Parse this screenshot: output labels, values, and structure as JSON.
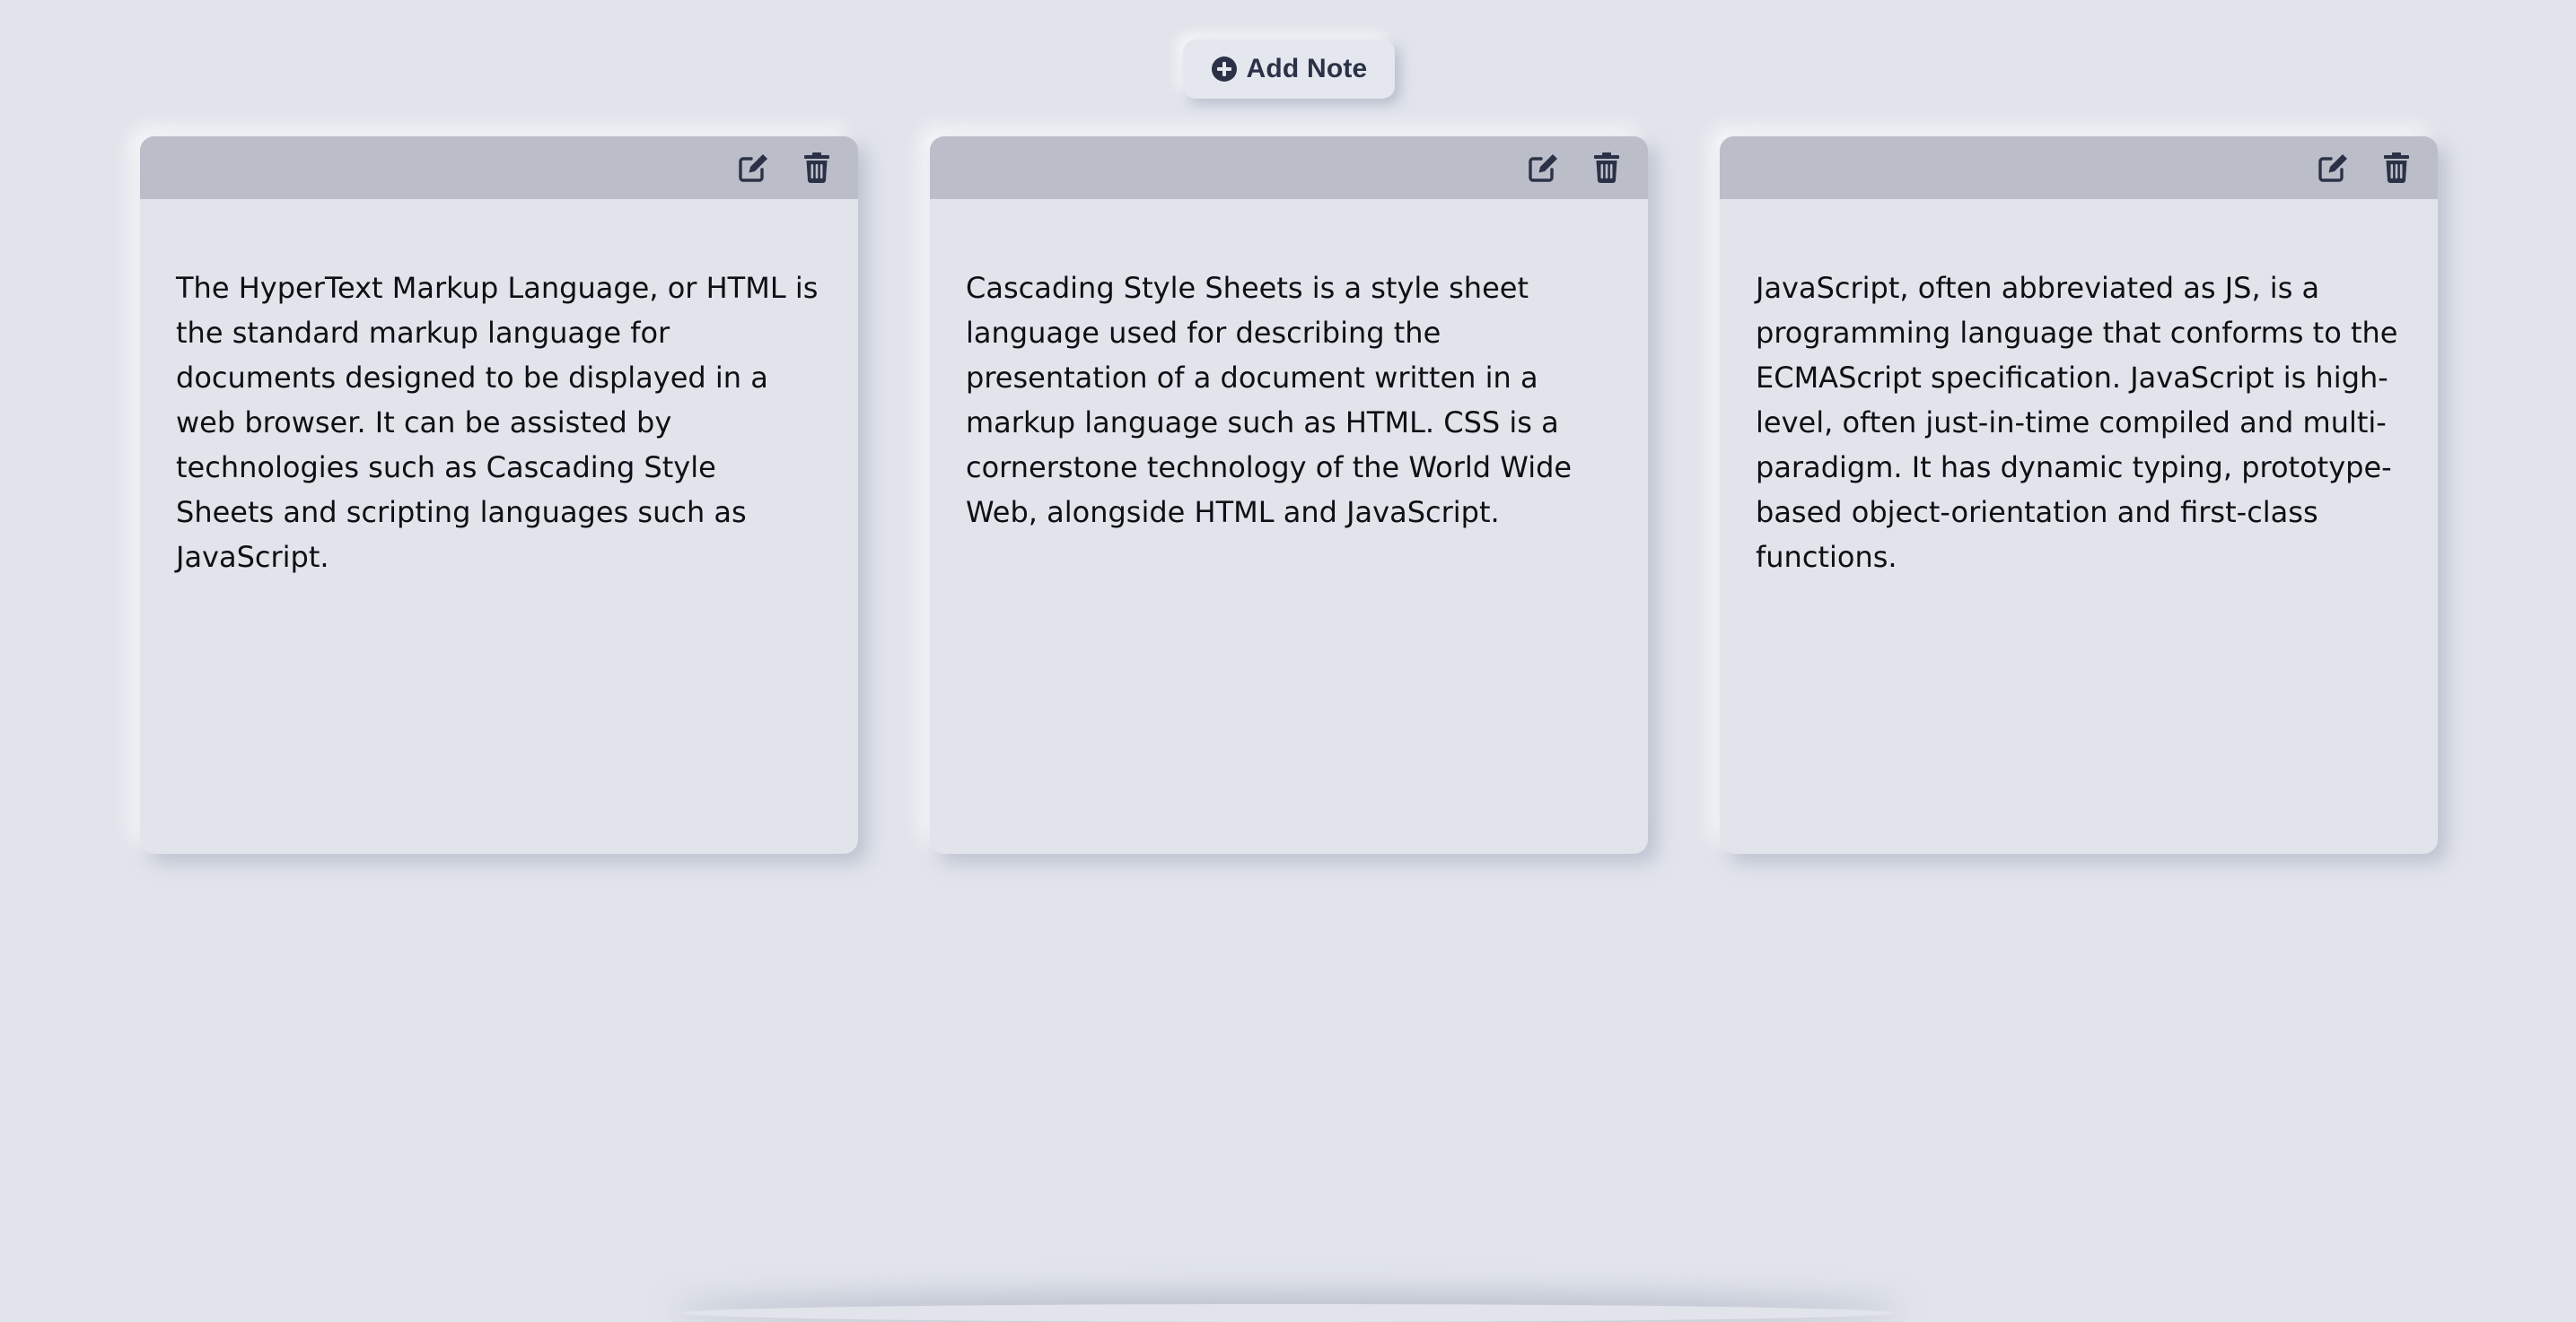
{
  "header": {
    "add_note_label": "Add Note",
    "add_note_icon": "plus-circle-icon"
  },
  "notes": [
    {
      "text": "The HyperText Markup Language, or HTML is the standard markup language for documents designed to be displayed in a web browser. It can be assisted by technologies such as Cascading Style Sheets and scripting languages such as JavaScript.",
      "edit_icon": "edit-icon",
      "delete_icon": "trash-icon"
    },
    {
      "text": "Cascading Style Sheets is a style sheet language used for describing the presentation of a document written in a markup language such as HTML. CSS is a cornerstone technology of the World Wide Web, alongside HTML and JavaScript.",
      "edit_icon": "edit-icon",
      "delete_icon": "trash-icon"
    },
    {
      "text": "JavaScript, often abbreviated as JS, is a programming language that conforms to the ECMAScript specification. JavaScript is high-level, often just-in-time compiled and multi-paradigm. It has dynamic typing, prototype-based object-orientation and first-class functions.",
      "edit_icon": "edit-icon",
      "delete_icon": "trash-icon"
    }
  ],
  "colors": {
    "background": "#e1e4eb",
    "toolbar": "#bbbec9",
    "icon": "#2b3247",
    "text": "#0f0f14"
  }
}
